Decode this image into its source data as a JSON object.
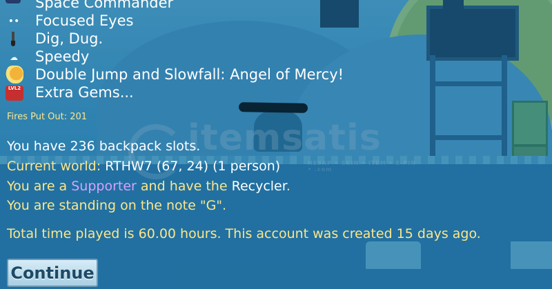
{
  "mods": [
    {
      "label": "Space Commander",
      "icon": "commander-helmet-icon"
    },
    {
      "label": "Focused Eyes",
      "icon": "eyes-icon"
    },
    {
      "label": "Dig, Dug.",
      "icon": "shovel-icon"
    },
    {
      "label": "Speedy",
      "icon": "speed-cloud-icon"
    },
    {
      "label": "Double Jump and Slowfall: Angel of Mercy!",
      "icon": "angel-wings-icon"
    },
    {
      "label": "Extra Gems...",
      "icon": "gem-badge-icon",
      "badge": "LVL2"
    }
  ],
  "stats": {
    "fires_put_out": "Fires Put Out: 201"
  },
  "info": {
    "backpack": "You have 236 backpack slots.",
    "world_prefix": "Current world: ",
    "world": "RTHW7 (67, 24) (1 person)",
    "role_prefix": "You are a ",
    "role": "Supporter",
    "role_middle": " and have the ",
    "role_item": "Recycler",
    "role_suffix": ".",
    "note": "You are standing on the note \"G\".",
    "played": "Total time played is 60.00 hours.  This account was created 15 days ago."
  },
  "watermark": {
    "text": "itemsatis",
    "sub": "HESAP • SKIN • ITEM • E-PIN • .com"
  },
  "buttons": {
    "continue": "Continue"
  },
  "colors": {
    "label_white": "#ffffff",
    "label_yellow": "#fde68a",
    "supporter_purple": "#d4a3ff",
    "button_bg": "#c5e2f1"
  }
}
